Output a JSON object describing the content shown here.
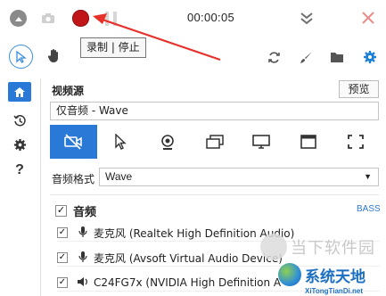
{
  "titlebar": {
    "timer": "00:00:05",
    "tooltip": "录制 | 停止"
  },
  "icons": {
    "collapse": "collapse-icon",
    "camera": "camera-icon",
    "record": "record-icon",
    "pause": "pause-icon",
    "minimize": "double-chevron-down-icon",
    "close": "close-icon",
    "cursor_mode": "cursor-icon",
    "hand": "hand-icon",
    "sync": "sync-icon",
    "brush": "brush-icon",
    "folder": "folder-icon",
    "settings": "gear-icon"
  },
  "colors": {
    "accent": "#2b79d6",
    "record": "#c0161a",
    "annotation_arrow": "#e8302a"
  },
  "nav": {
    "items": [
      "home",
      "history",
      "settings",
      "help"
    ],
    "help_label": "?"
  },
  "video_source": {
    "label": "视频源",
    "preview_label": "预览",
    "value": "仅音频 - Wave"
  },
  "capture_modes": [
    "no-video",
    "cursor",
    "webcam",
    "windows",
    "screen",
    "window",
    "region"
  ],
  "audio_format": {
    "label": "音频格式",
    "value": "Wave"
  },
  "audio": {
    "title": "音频",
    "engine": "BASS",
    "devices": [
      {
        "label": "麦克风 (Realtek High Definition Audio)",
        "type": "microphone",
        "checked": true
      },
      {
        "label": "麦克风 (Avsoft Virtual Audio Device)",
        "type": "microphone",
        "checked": true
      },
      {
        "label": "C24FG7x (NVIDIA High Definition A",
        "type": "speaker",
        "checked": true
      }
    ]
  },
  "watermark": {
    "top_text": "当下软件园",
    "main_text": "系统天地",
    "sub_text": "XiTongTianDi.net"
  }
}
